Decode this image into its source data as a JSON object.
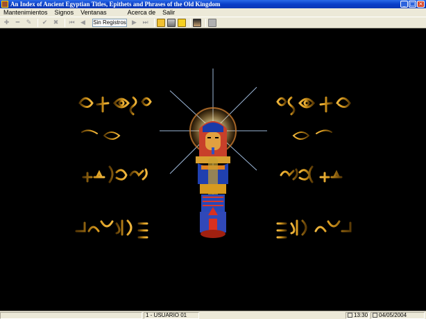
{
  "window": {
    "title": "An Index of Ancient Egyptian Titles, Epithets and Phrases of the Old Kingdom",
    "minimize": "_",
    "maximize": "□",
    "close": "×"
  },
  "menu": {
    "items": [
      "Mantenimientos",
      "Signos",
      "Ventanas",
      "Acerca de",
      "Salir"
    ]
  },
  "toolbar": {
    "record_field": "Sin Registros",
    "icons": [
      "add-icon",
      "remove-icon",
      "edit-icon",
      "confirm-icon",
      "cancel-icon",
      "first-record-icon",
      "prev-record-icon",
      "next-record-icon",
      "last-record-icon",
      "sign-icon",
      "sign-list-icon",
      "sign-search-icon",
      "pharaoh-icon",
      "exit-icon"
    ]
  },
  "status": {
    "user": "1 - USUARIO 01",
    "time": "13:30",
    "date": "04/05/2004"
  },
  "colors": {
    "title_blue": "#0a3fc9",
    "chrome": "#ece9d8",
    "hieroglyph_gold": "#d89a1e",
    "background": "#000000"
  }
}
